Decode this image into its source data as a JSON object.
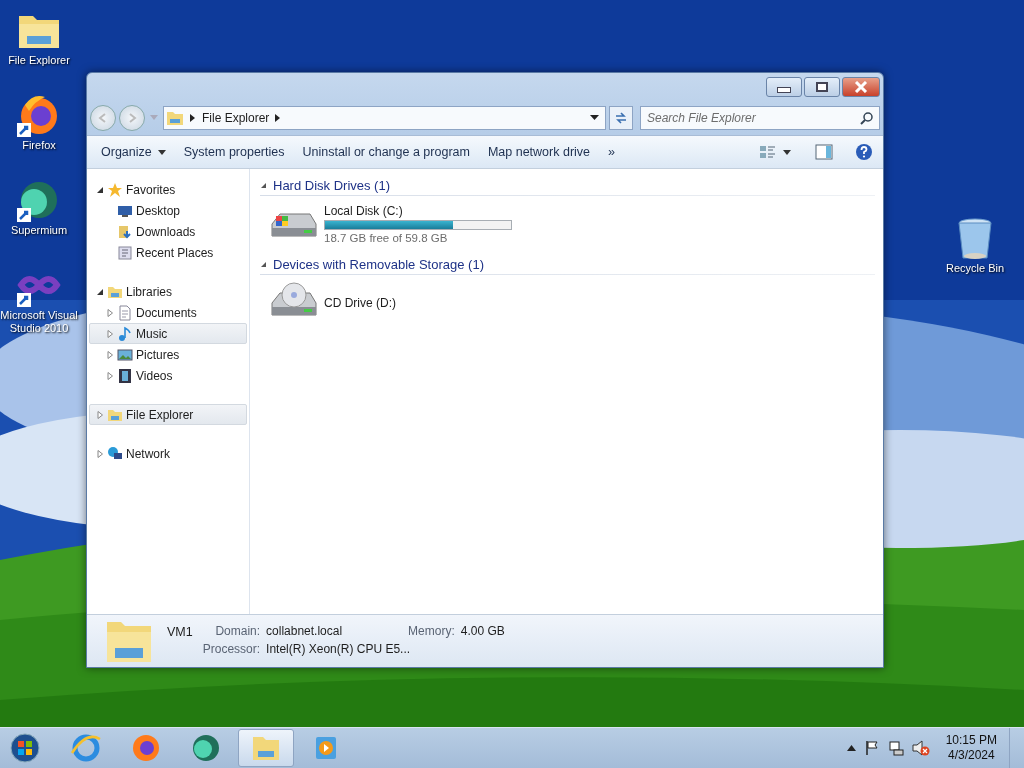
{
  "desktop_icons": [
    {
      "label": "File Explorer",
      "kind": "folder"
    },
    {
      "label": "Firefox",
      "kind": "firefox"
    },
    {
      "label": "Supermium",
      "kind": "supermium"
    },
    {
      "label": "Microsoft Visual Studio 2010",
      "kind": "vs"
    }
  ],
  "recycle_bin": {
    "label": "Recycle Bin"
  },
  "window": {
    "address": {
      "crumbs": [
        "File Explorer"
      ]
    },
    "search": {
      "placeholder": "Search File Explorer"
    },
    "toolbar": [
      {
        "label": "Organize",
        "kind": "menu"
      },
      {
        "label": "System properties",
        "kind": "plain"
      },
      {
        "label": "Uninstall or change a program",
        "kind": "plain"
      },
      {
        "label": "Map network drive",
        "kind": "plain"
      },
      {
        "label": "»",
        "kind": "plain"
      }
    ],
    "nav": [
      {
        "label": "Favorites",
        "kind": "star",
        "expanded": true,
        "selected": false,
        "children": [
          {
            "label": "Desktop",
            "kind": "desktop",
            "selected": false
          },
          {
            "label": "Downloads",
            "kind": "downloads",
            "selected": false
          },
          {
            "label": "Recent Places",
            "kind": "recent",
            "selected": false
          }
        ]
      },
      {
        "label": "Libraries",
        "kind": "library",
        "expanded": true,
        "selected": false,
        "children": [
          {
            "label": "Documents",
            "kind": "documents",
            "expanded": false,
            "selected": false
          },
          {
            "label": "Music",
            "kind": "music",
            "expanded": false,
            "selected": true
          },
          {
            "label": "Pictures",
            "kind": "pictures",
            "expanded": false,
            "selected": false
          },
          {
            "label": "Videos",
            "kind": "videos",
            "expanded": false,
            "selected": false
          }
        ]
      },
      {
        "label": "File Explorer",
        "kind": "library",
        "expanded": false,
        "selected": true
      },
      {
        "label": "Network",
        "kind": "network",
        "expanded": false,
        "selected": false
      }
    ],
    "groups": [
      {
        "title": "Hard Disk Drives (1)",
        "expanded": true,
        "items": [
          {
            "name": "Local Disk (C:)",
            "kind": "hdd",
            "level": 0.69,
            "detail": "18.7 GB free of 59.8 GB"
          }
        ]
      },
      {
        "title": "Devices with Removable Storage (1)",
        "expanded": true,
        "items": [
          {
            "name": "CD Drive (D:)",
            "kind": "cd"
          }
        ]
      }
    ],
    "details": {
      "name": "VM1",
      "fields": [
        {
          "label": "Domain:",
          "value": "collabnet.local"
        },
        {
          "label": "Memory:",
          "value": "4.00 GB"
        },
        {
          "label": "Processor:",
          "value": "Intel(R) Xeon(R) CPU E5..."
        }
      ]
    }
  },
  "taskbar": {
    "apps": [
      {
        "kind": "ie",
        "selected": false
      },
      {
        "kind": "firefox",
        "selected": false
      },
      {
        "kind": "supermium",
        "selected": false
      },
      {
        "kind": "folder",
        "selected": true
      },
      {
        "kind": "media",
        "selected": false
      }
    ],
    "tray": {
      "muted": true
    },
    "clock": {
      "time": "10:15 PM",
      "date": "4/3/2024"
    }
  }
}
